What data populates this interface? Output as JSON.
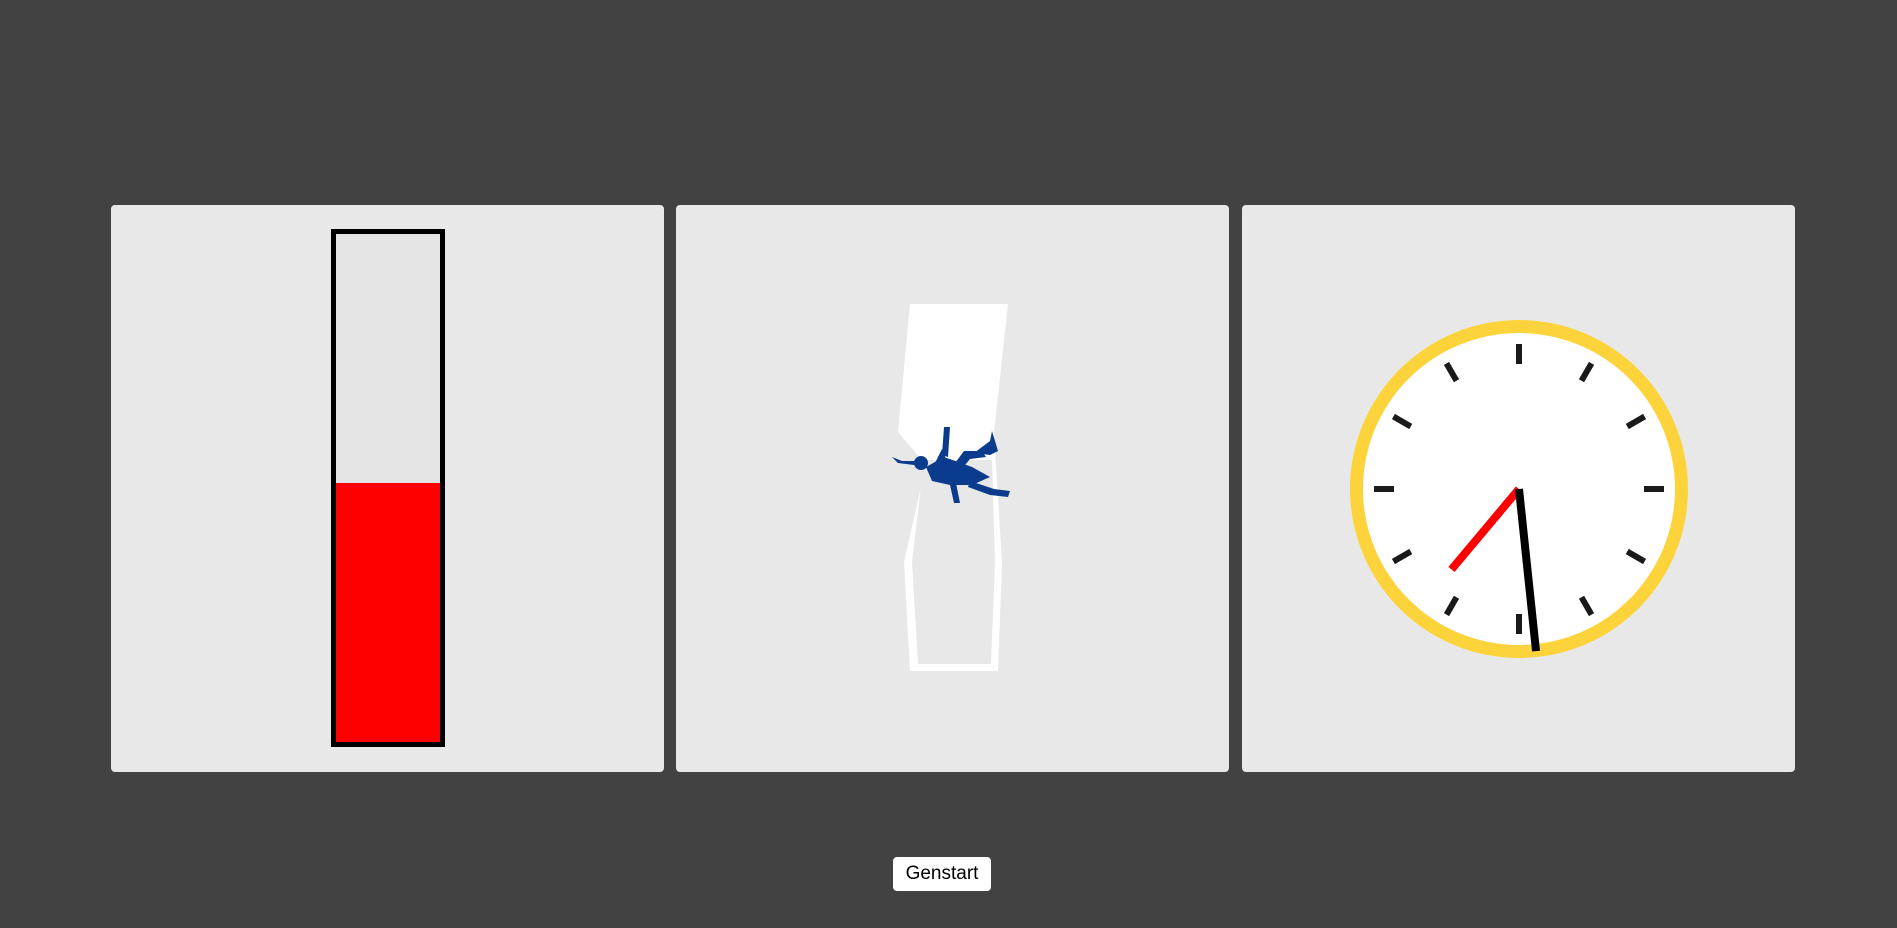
{
  "colors": {
    "background": "#424242",
    "panel": "#e8e8e8",
    "thermometer_fill": "#ff0000",
    "clock_rim": "#fdd33b",
    "hour_hand": "#ff0000",
    "minute_hand": "#000000",
    "figure": "#0a3b8c"
  },
  "thermometer": {
    "fill_fraction": 0.51
  },
  "clock": {
    "hour_hand_angle_deg": 220,
    "minute_hand_angle_deg": 174
  },
  "controls": {
    "restart_label": "Genstart"
  }
}
